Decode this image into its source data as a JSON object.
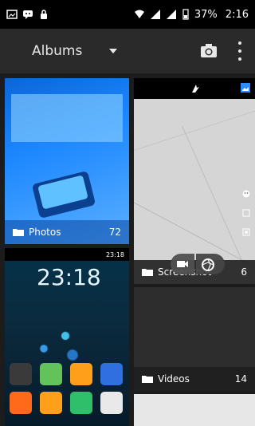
{
  "status_bar": {
    "battery_percent": "37%",
    "time": "2:16"
  },
  "action_bar": {
    "title": "Albums"
  },
  "albums": [
    {
      "name": "Photos",
      "count": "72"
    },
    {
      "name": "Screenshot",
      "count": "6"
    },
    {
      "name": "Videos",
      "count": "14"
    }
  ],
  "phone_preview": {
    "clock": "23:18",
    "status_time": "23:18"
  },
  "colors": {
    "statusbar_bg": "#000000",
    "actionbar_bg": "#2a2a2a",
    "photos_tint": "#1d88ff"
  }
}
